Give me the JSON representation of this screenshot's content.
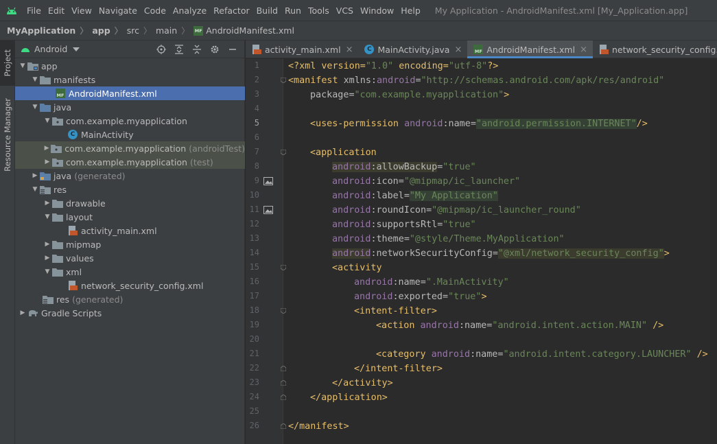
{
  "menubar": {
    "items": [
      "File",
      "Edit",
      "View",
      "Navigate",
      "Code",
      "Analyze",
      "Refactor",
      "Build",
      "Run",
      "Tools",
      "VCS",
      "Window",
      "Help"
    ],
    "window_title": "My Application - AndroidManifest.xml [My_Application.app]"
  },
  "breadcrumb": [
    "MyApplication",
    "app",
    "src",
    "main",
    "AndroidManifest.xml"
  ],
  "strip": {
    "project_label": "Project",
    "resource_label": "Resource Manager"
  },
  "panel": {
    "view_label": "Android"
  },
  "tree": [
    {
      "label": "app",
      "extra": ""
    },
    {
      "label": "manifests",
      "extra": ""
    },
    {
      "label": "AndroidManifest.xml",
      "extra": ""
    },
    {
      "label": "java",
      "extra": ""
    },
    {
      "label": "com.example.myapplication",
      "extra": ""
    },
    {
      "label": "MainActivity",
      "extra": ""
    },
    {
      "label": "com.example.myapplication",
      "extra": "(androidTest)"
    },
    {
      "label": "com.example.myapplication",
      "extra": "(test)"
    },
    {
      "label": "java",
      "extra": "(generated)"
    },
    {
      "label": "res",
      "extra": ""
    },
    {
      "label": "drawable",
      "extra": ""
    },
    {
      "label": "layout",
      "extra": ""
    },
    {
      "label": "activity_main.xml",
      "extra": ""
    },
    {
      "label": "mipmap",
      "extra": ""
    },
    {
      "label": "values",
      "extra": ""
    },
    {
      "label": "xml",
      "extra": ""
    },
    {
      "label": "network_security_config.xml",
      "extra": ""
    },
    {
      "label": "res",
      "extra": "(generated)"
    },
    {
      "label": "Gradle Scripts",
      "extra": ""
    }
  ],
  "tabs": [
    "activity_main.xml",
    "MainActivity.java",
    "AndroidManifest.xml",
    "network_security_config.xml"
  ],
  "icons": {
    "mf": "MF",
    "java": "C",
    "xml": "</>"
  },
  "code": {
    "lines": [
      "1",
      "2",
      "3",
      "4",
      "5",
      "6",
      "7",
      "8",
      "9",
      "10",
      "11",
      "12",
      "13",
      "14",
      "15",
      "16",
      "17",
      "18",
      "19",
      "20",
      "21",
      "22",
      "23",
      "24",
      "25",
      "26"
    ],
    "l1": {
      "a": "<?xml version=",
      "b": "\"1.0\"",
      "c": " encoding=",
      "d": "\"utf-8\"",
      "e": "?>"
    },
    "l2": {
      "a": "<manifest ",
      "b": "xmlns:",
      "c": "android",
      "d": "=",
      "e": "\"http://schemas.android.com/apk/res/android\""
    },
    "l3": {
      "a": "package",
      "b": "=",
      "c": "\"com.example.myapplication\"",
      "d": ">"
    },
    "l5": {
      "a": "<uses-permission ",
      "b": "android",
      "c": ":name",
      "d": "=",
      "e": "\"android.permission.INTERNET\"",
      "f": "/>"
    },
    "l7": {
      "a": "<application"
    },
    "l8": {
      "ns": "android",
      "attr": ":allowBackup",
      "eq": "=",
      "val": "\"true\""
    },
    "l9": {
      "ns": "android",
      "attr": ":icon",
      "eq": "=",
      "val": "\"@mipmap/ic_launcher\""
    },
    "l10": {
      "ns": "android",
      "attr": ":label",
      "eq": "=",
      "val": "\"My Application\""
    },
    "l11": {
      "ns": "android",
      "attr": ":roundIcon",
      "eq": "=",
      "val": "\"@mipmap/ic_launcher_round\""
    },
    "l12": {
      "ns": "android",
      "attr": ":supportsRtl",
      "eq": "=",
      "val": "\"true\""
    },
    "l13": {
      "ns": "android",
      "attr": ":theme",
      "eq": "=",
      "val": "\"@style/Theme.MyApplication\""
    },
    "l14": {
      "ns": "android",
      "attr": ":networkSecurityConfig",
      "eq": "=",
      "val": "\"@xml/network_security_config\"",
      "end": ">"
    },
    "l15": {
      "a": "<activity"
    },
    "l16": {
      "ns": "android",
      "attr": ":name",
      "eq": "=",
      "val": "\".MainActivity\""
    },
    "l17": {
      "ns": "android",
      "attr": ":exported",
      "eq": "=",
      "val": "\"true\"",
      "end": ">"
    },
    "l18": {
      "a": "<intent-filter>"
    },
    "l19": {
      "a": "<action ",
      "ns": "android",
      "attr": ":name",
      "eq": "=",
      "val": "\"android.intent.action.MAIN\"",
      "end": " />"
    },
    "l21": {
      "a": "<category ",
      "ns": "android",
      "attr": ":name",
      "eq": "=",
      "val": "\"android.intent.category.LAUNCHER\"",
      "end": " />"
    },
    "l22": {
      "a": "</intent-filter>"
    },
    "l23": {
      "a": "</activity>"
    },
    "l24": {
      "a": "</application>"
    },
    "l26": {
      "a": "</manifest>"
    }
  }
}
